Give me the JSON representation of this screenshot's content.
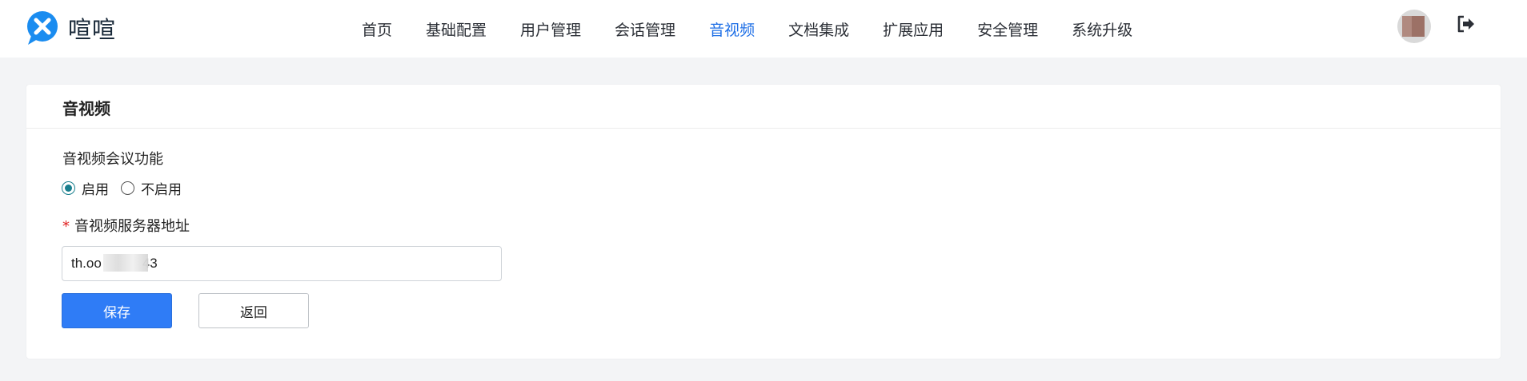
{
  "app": {
    "name": "喧喧"
  },
  "nav": {
    "items": [
      {
        "label": "首页",
        "active": false
      },
      {
        "label": "基础配置",
        "active": false
      },
      {
        "label": "用户管理",
        "active": false
      },
      {
        "label": "会话管理",
        "active": false
      },
      {
        "label": "音视频",
        "active": true
      },
      {
        "label": "文档集成",
        "active": false
      },
      {
        "label": "扩展应用",
        "active": false
      },
      {
        "label": "安全管理",
        "active": false
      },
      {
        "label": "系统升级",
        "active": false
      }
    ]
  },
  "header": {
    "avatar_icon": "user-avatar",
    "logout_icon": "logout-icon"
  },
  "card": {
    "title": "音视频",
    "section_label": "音视频会议功能",
    "radio_options": [
      {
        "label": "启用",
        "checked": true
      },
      {
        "label": "不启用",
        "checked": false
      }
    ],
    "required_mark": "*",
    "field_label": "音视频服务器地址",
    "server_address": "th.oo   43",
    "save_label": "保存",
    "back_label": "返回"
  },
  "colors": {
    "accent": "#2f7cf6",
    "nav_active": "#1e6fe6",
    "radio": "#1a7f8e",
    "logo": "#1a8cf0"
  }
}
